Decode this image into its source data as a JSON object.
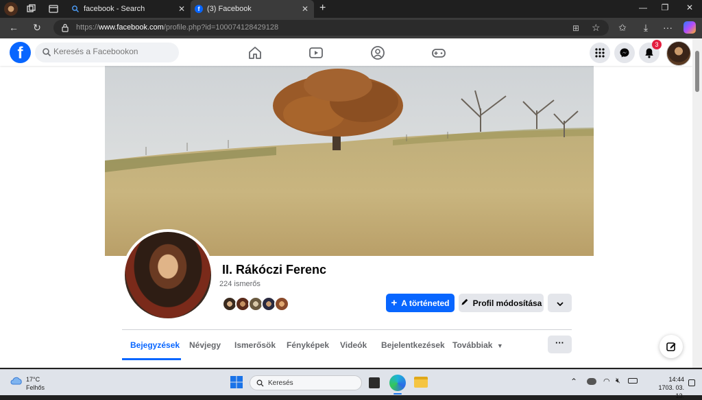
{
  "browser": {
    "tabs": [
      {
        "title": "facebook - Search"
      },
      {
        "title": "(3) Facebook"
      }
    ],
    "url_prefix": "https://",
    "url_host": "www.facebook.com",
    "url_path": "/profile.php?id=100074128429128"
  },
  "fb": {
    "logo": "f",
    "search_placeholder": "Keresés a Facebookon",
    "notification_count": "3"
  },
  "profile": {
    "name": "II. Rákóczi Ferenc",
    "friends": "224 ismerős",
    "story_button": "A történeted",
    "edit_button": "Profil módosítása"
  },
  "tabs": {
    "items": [
      "Bejegyzések",
      "Névjegy",
      "Ismerősök",
      "Fényképek",
      "Videók",
      "Bejelentkezések",
      "Továbbiak"
    ],
    "more_dots": "···"
  },
  "taskbar": {
    "temp": "17°C",
    "weather": "Felhős",
    "search": "Keresés",
    "time": "14:44",
    "date": "1703. 03. 13."
  },
  "colors": {
    "fb_blue": "#0866ff",
    "badge_red": "#e41e3f"
  }
}
